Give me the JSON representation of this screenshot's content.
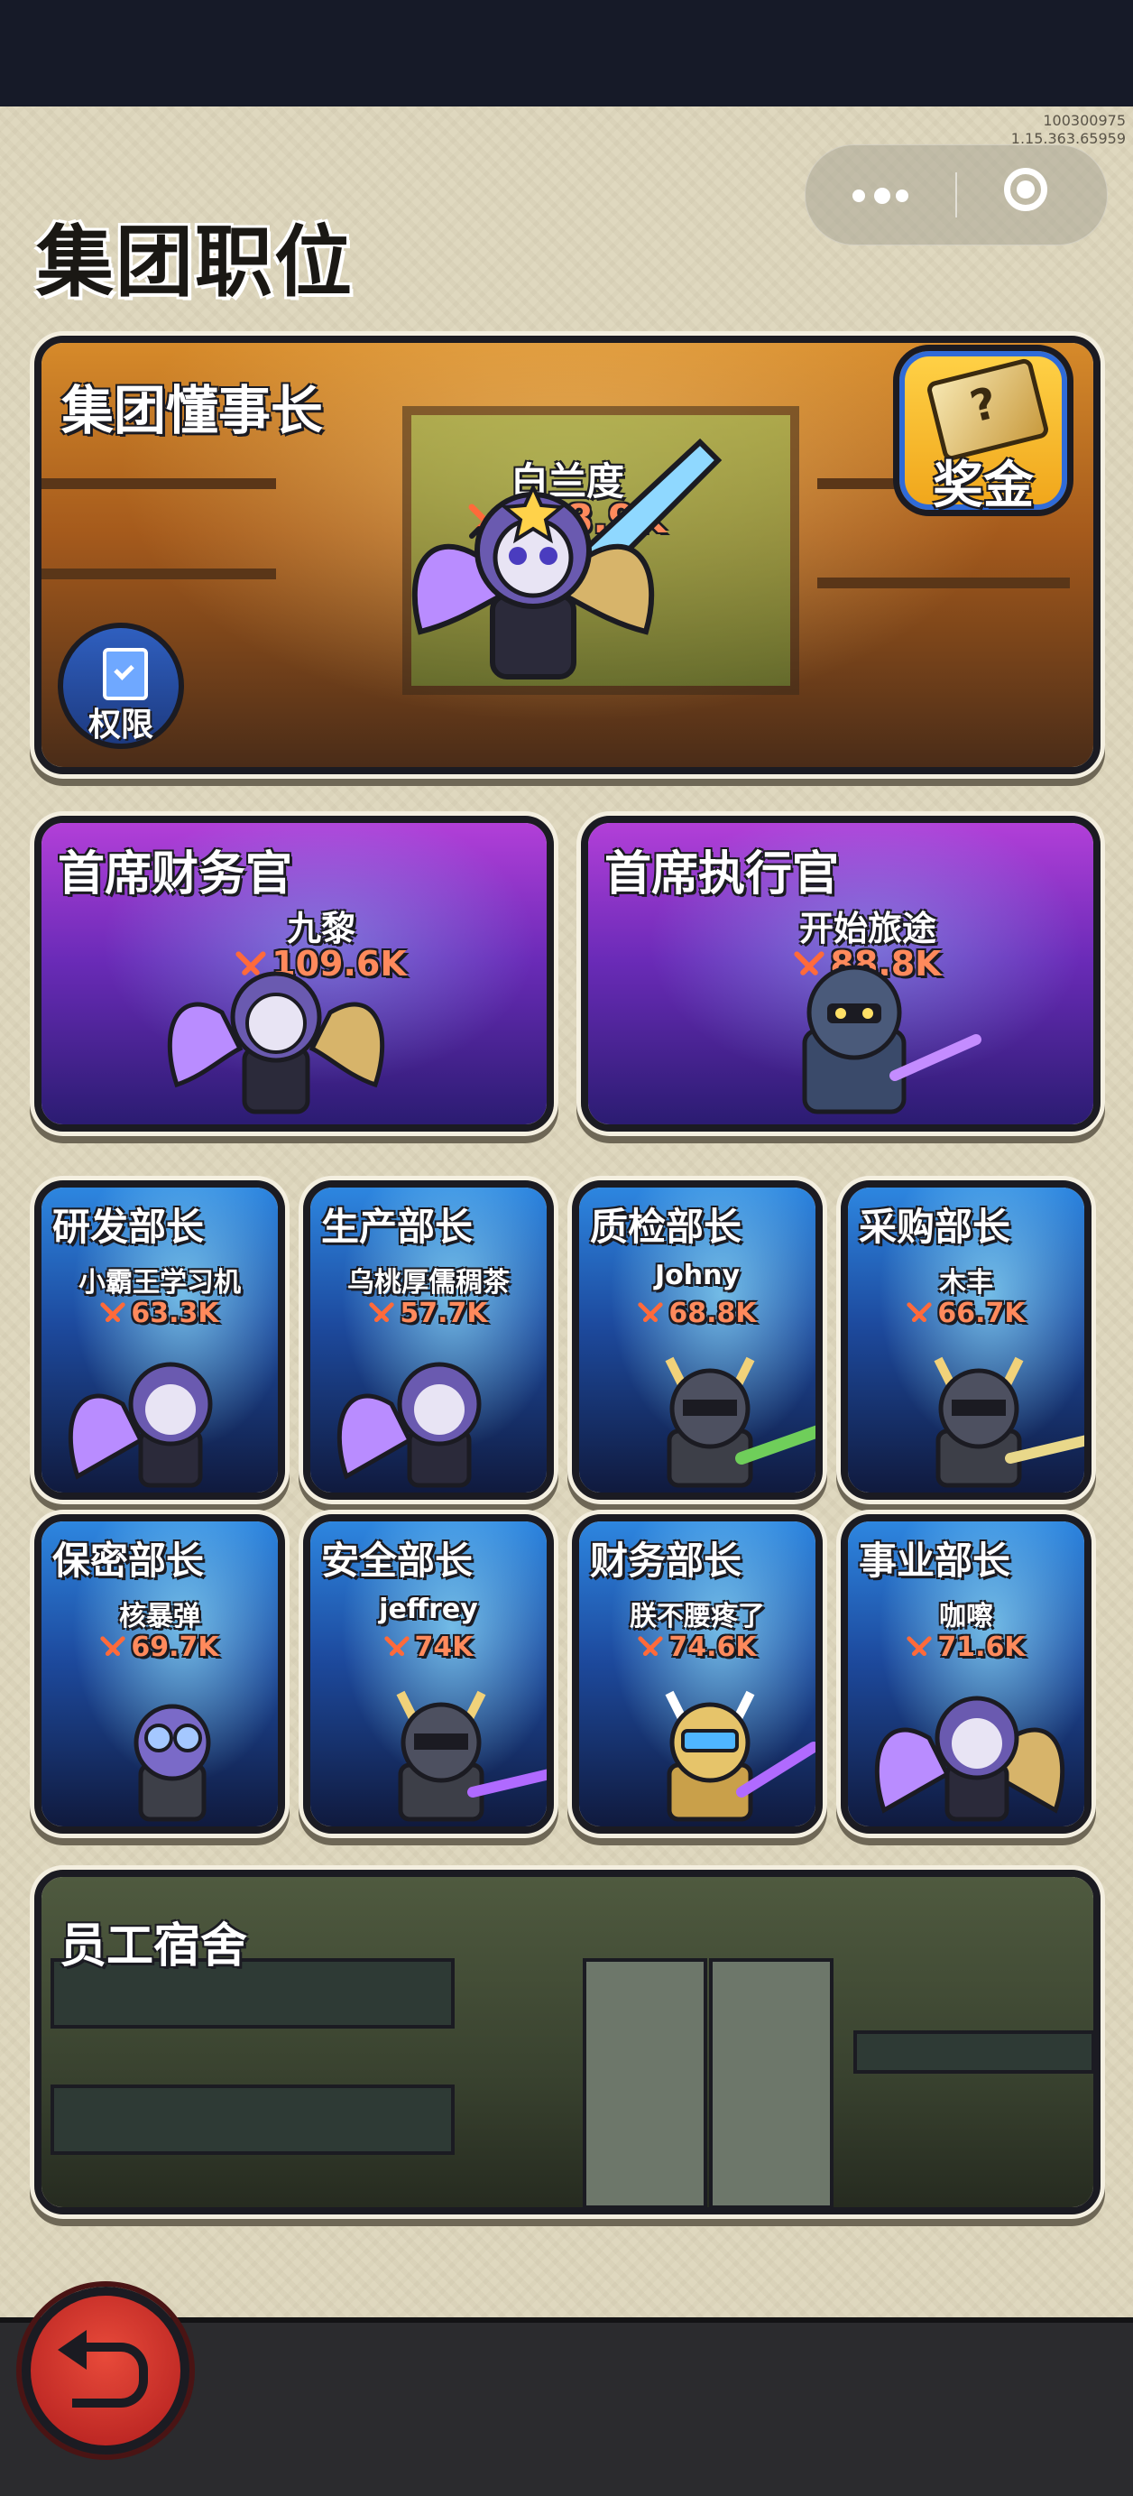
{
  "system": {
    "build_id": "100300975",
    "build_version": "1.15.363.65959"
  },
  "page": {
    "title": "集团职位"
  },
  "chairman": {
    "title": "集团懂事长",
    "player": "白兰度",
    "power": "128.9K",
    "bonus_label": "奖金",
    "permission_label": "权限"
  },
  "executives": [
    {
      "title": "首席财务官",
      "player": "九黎",
      "power": "109.6K"
    },
    {
      "title": "首席执行官",
      "player": "开始旅途",
      "power": "88.8K"
    }
  ],
  "ministers_row1": [
    {
      "title": "研发部长",
      "player": "小霸王学习机",
      "power": "63.3K"
    },
    {
      "title": "生产部长",
      "player": "乌桃厚儒稠茶",
      "power": "57.7K"
    },
    {
      "title": "质检部长",
      "player": "Johny",
      "power": "68.8K"
    },
    {
      "title": "采购部长",
      "player": "木丰",
      "power": "66.7K"
    }
  ],
  "ministers_row2": [
    {
      "title": "保密部长",
      "player": "核暴弹",
      "power": "69.7K"
    },
    {
      "title": "安全部长",
      "player": "jeffrey",
      "power": "74K"
    },
    {
      "title": "财务部长",
      "player": "朕不腰疼了",
      "power": "74.6K"
    },
    {
      "title": "事业部长",
      "player": "咖嚓",
      "power": "71.6K"
    }
  ],
  "dorm": {
    "title": "员工宿舍"
  },
  "icons": {
    "power": "crossed-swords-icon",
    "back": "back-arrow-icon",
    "menu": "more-dots-icon",
    "close": "target-close-icon",
    "bonus": "ticket-icon",
    "permission": "clipboard-check-icon"
  }
}
